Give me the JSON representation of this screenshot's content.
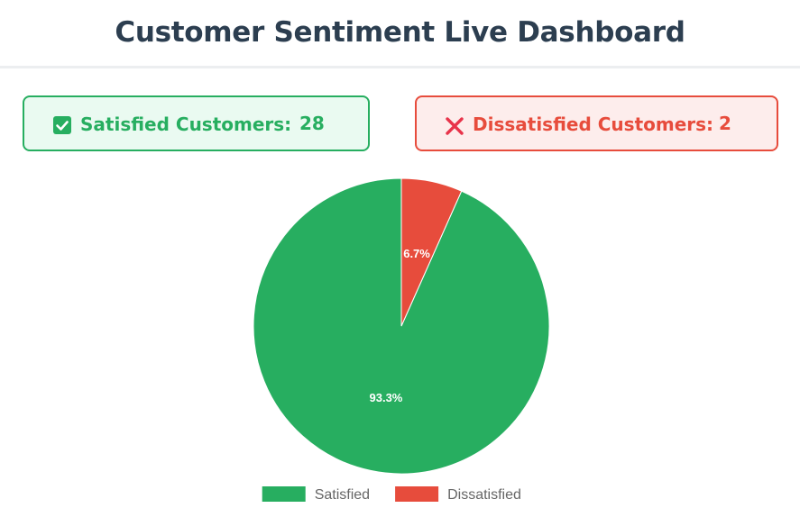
{
  "header": {
    "title": "Customer Sentiment Live Dashboard"
  },
  "stats": {
    "satisfied": {
      "icon": "checkbox-check-icon",
      "label": "Satisfied Customers:",
      "value": "28",
      "color": "#27ae60"
    },
    "dissatisfied": {
      "icon": "x-mark-icon",
      "label": "Dissatisfied Customers:",
      "value": "2",
      "color": "#e74c3c"
    }
  },
  "chart_data": {
    "type": "pie",
    "categories": [
      "Satisfied",
      "Dissatisfied"
    ],
    "values": [
      28,
      2
    ],
    "percent_labels": [
      "93.3%",
      "6.7%"
    ],
    "colors": [
      "#27ae60",
      "#e74c3c"
    ],
    "legend": {
      "position": "bottom",
      "entries": [
        "Satisfied",
        "Dissatisfied"
      ]
    }
  }
}
